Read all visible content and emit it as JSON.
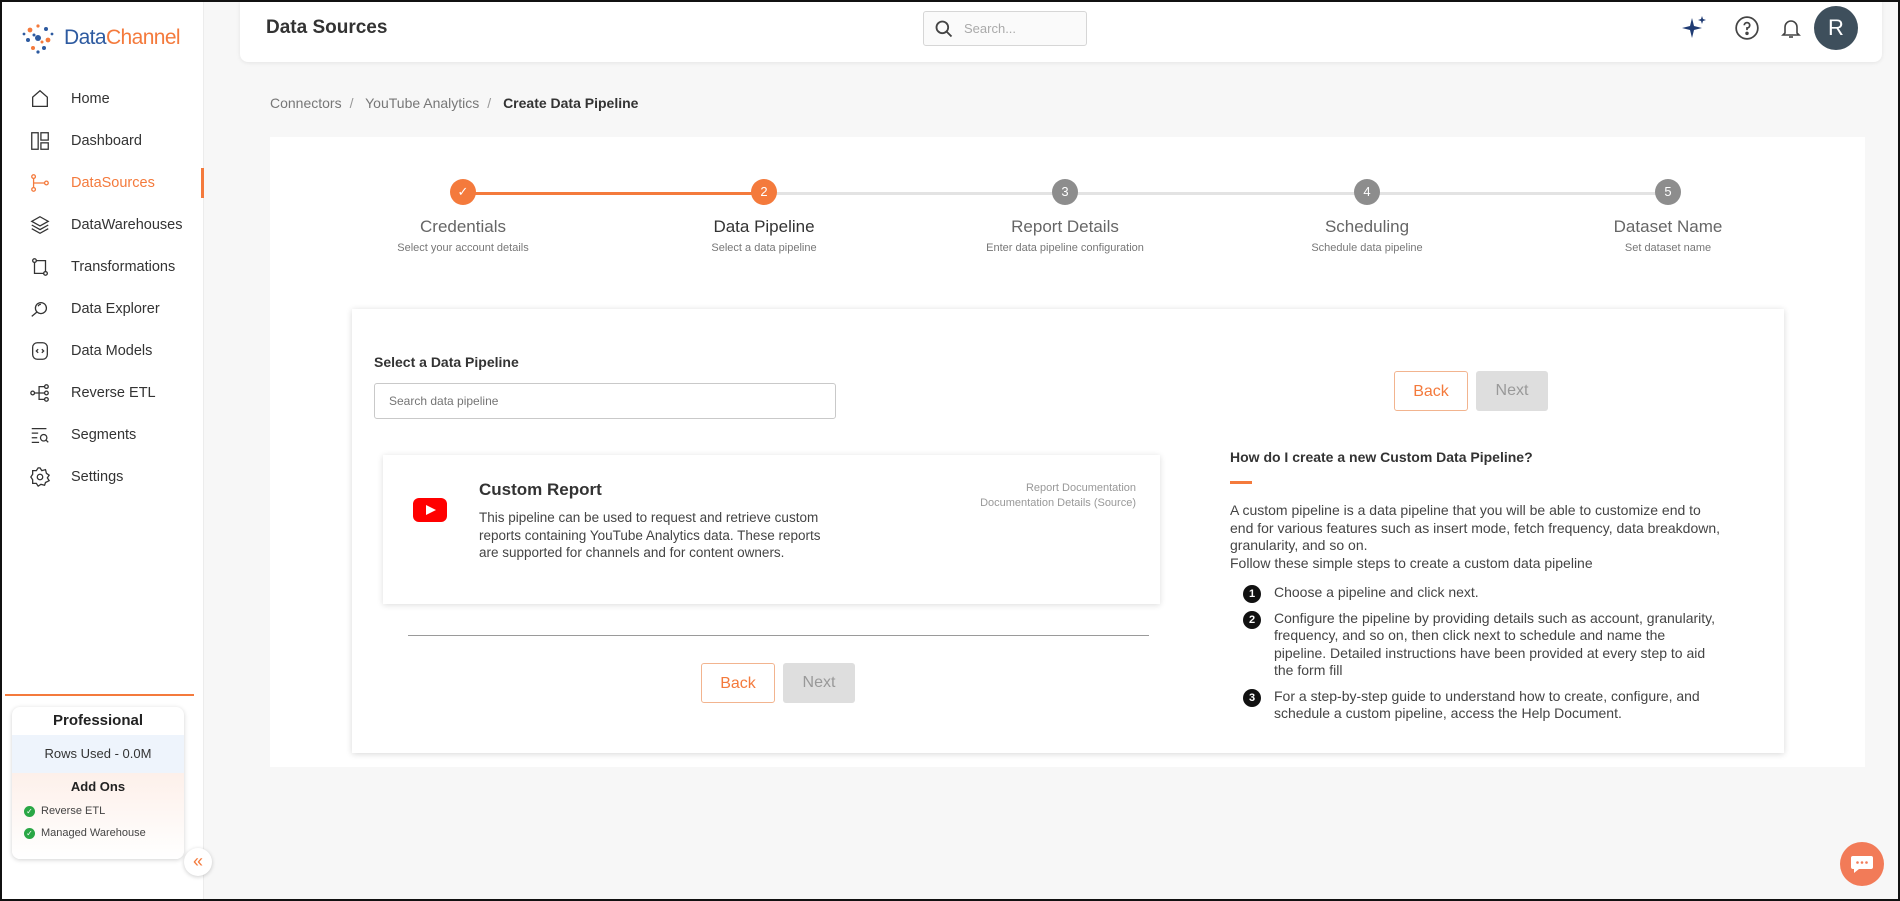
{
  "brand": {
    "name_part1": "Data",
    "name_part2": "Channel",
    "accent": "#f47a3c"
  },
  "sidebar": {
    "items": [
      {
        "label": "Home",
        "icon": "home-icon"
      },
      {
        "label": "Dashboard",
        "icon": "dashboard-icon"
      },
      {
        "label": "DataSources",
        "icon": "datasources-icon",
        "active": true
      },
      {
        "label": "DataWarehouses",
        "icon": "layers-icon"
      },
      {
        "label": "Transformations",
        "icon": "transform-icon"
      },
      {
        "label": "Data Explorer",
        "icon": "explorer-icon"
      },
      {
        "label": "Data Models",
        "icon": "model-icon"
      },
      {
        "label": "Reverse ETL",
        "icon": "reverse-etl-icon"
      },
      {
        "label": "Segments",
        "icon": "segments-icon"
      },
      {
        "label": "Settings",
        "icon": "gear-icon"
      }
    ],
    "plan": {
      "title": "Professional",
      "rows_used": "Rows Used - 0.0M",
      "addons_title": "Add Ons",
      "addons": [
        "Reverse ETL",
        "Managed Warehouse"
      ]
    }
  },
  "header": {
    "title": "Data Sources",
    "search_placeholder": "Search...",
    "avatar_initial": "R"
  },
  "breadcrumb": [
    "Connectors",
    "YouTube Analytics",
    "Create Data Pipeline"
  ],
  "steps": [
    {
      "num": "✓",
      "label": "Credentials",
      "sub": "Select your account details",
      "state": "done"
    },
    {
      "num": "2",
      "label": "Data Pipeline",
      "sub": "Select a data pipeline",
      "state": "current"
    },
    {
      "num": "3",
      "label": "Report Details",
      "sub": "Enter data pipeline configuration",
      "state": "todo"
    },
    {
      "num": "4",
      "label": "Scheduling",
      "sub": "Schedule data pipeline",
      "state": "todo"
    },
    {
      "num": "5",
      "label": "Dataset Name",
      "sub": "Set dataset name",
      "state": "todo"
    }
  ],
  "pipeline": {
    "section_title": "Select a Data Pipeline",
    "search_placeholder": "Search data pipeline",
    "back_label": "Back",
    "next_label": "Next",
    "report": {
      "title": "Custom Report",
      "description": "This pipeline can be used to request and retrieve custom reports containing YouTube Analytics data. These reports are supported for channels and for content owners.",
      "link1": "Report Documentation",
      "link2": "Documentation Details (Source)"
    }
  },
  "howto": {
    "title": "How do I create a new Custom Data Pipeline?",
    "intro1": "A custom pipeline is a data pipeline that you will be able to customize end to end for various features such as insert mode, fetch frequency, data breakdown, granularity, and so on.",
    "intro2": "Follow these simple steps to create a custom data pipeline",
    "steps": [
      {
        "num": "1",
        "text": "Choose a pipeline and click next."
      },
      {
        "num": "2",
        "text": "Configure the pipeline by providing details such as account, granularity, frequency, and so on, then click next to schedule and name the pipeline. Detailed instructions have been provided at every step to aid the form fill"
      },
      {
        "num": "3",
        "text": "For a step-by-step guide to understand how to create, configure, and schedule a custom pipeline, access the Help Document."
      }
    ]
  }
}
